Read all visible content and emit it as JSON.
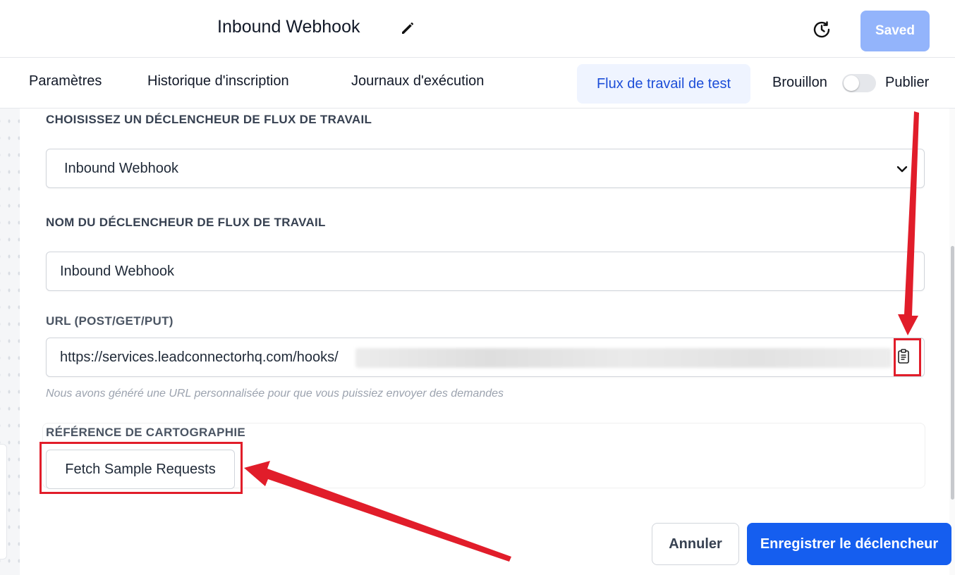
{
  "header": {
    "title": "Inbound Webhook",
    "saved_label": "Saved"
  },
  "tabs": [
    {
      "label": "Paramètres"
    },
    {
      "label": "Historique d'inscription"
    },
    {
      "label": "Journaux d'exécution"
    }
  ],
  "test_tab": {
    "label": "Flux de travail de test"
  },
  "publish_toggle": {
    "draft_label": "Brouillon",
    "publish_label": "Publier",
    "state": "draft"
  },
  "form": {
    "trigger_section_label": "CHOISISSEZ UN DÉCLENCHEUR DE FLUX DE TRAVAIL",
    "trigger_value": "Inbound Webhook",
    "name_section_label": "NOM DU DÉCLENCHEUR DE FLUX DE TRAVAIL",
    "name_value": "Inbound Webhook",
    "url_section_label": "URL (POST/GET/PUT)",
    "url_value": "https://services.leadconnectorhq.com/hooks/",
    "url_hint": "Nous avons généré une URL personnalisée pour que vous puissiez envoyer des demandes",
    "mapping_section_label": "RÉFÉRENCE DE CARTOGRAPHIE",
    "fetch_label": "Fetch Sample Requests"
  },
  "footer": {
    "cancel_label": "Annuler",
    "save_label": "Enregistrer le déclencheur"
  },
  "colors": {
    "primary": "#155eef",
    "saved_disabled": "#93b4fb",
    "annotation": "#e11d2a"
  }
}
